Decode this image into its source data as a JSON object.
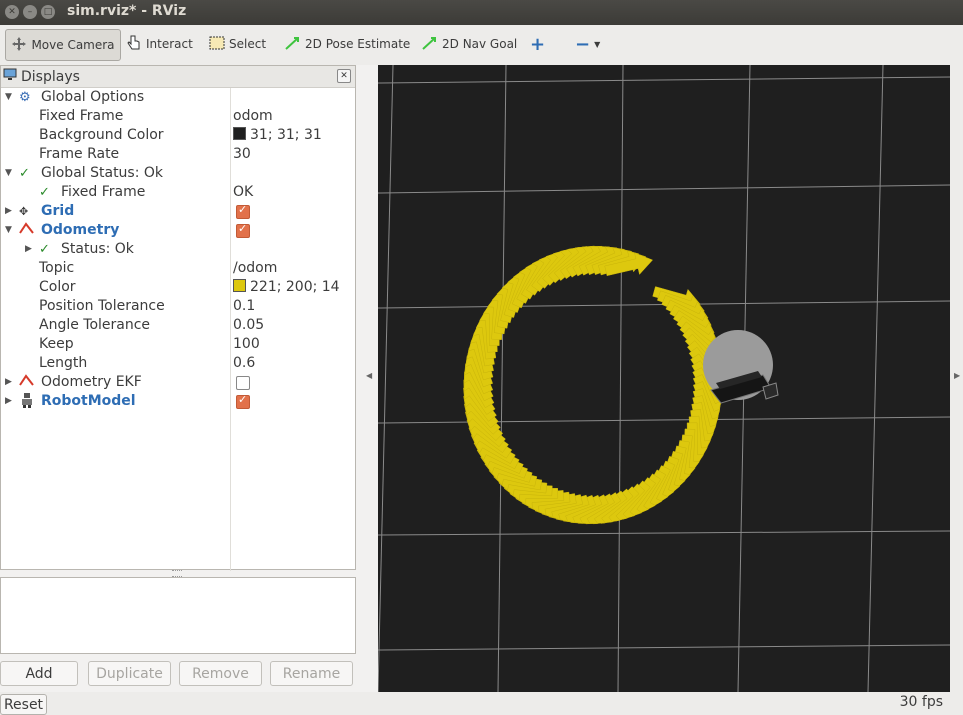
{
  "window": {
    "title": "sim.rviz* - RViz"
  },
  "toolbar": {
    "tools": [
      {
        "label": "Move Camera",
        "icon": "move-camera-icon"
      },
      {
        "label": "Interact",
        "icon": "hand-pointer-icon"
      },
      {
        "label": "Select",
        "icon": "select-box-icon"
      },
      {
        "label": "2D Pose Estimate",
        "icon": "green-arrow-icon"
      },
      {
        "label": "2D Nav Goal",
        "icon": "green-arrow-icon"
      }
    ],
    "add_icon": "plus-icon",
    "remove_icon": "minus-icon"
  },
  "displays": {
    "title": "Displays",
    "rows": [
      {
        "label": "Global Options",
        "value": ""
      },
      {
        "label": "Fixed Frame",
        "value": "odom"
      },
      {
        "label": "Background Color",
        "value": "31; 31; 31",
        "swatch": "#1f1f1f"
      },
      {
        "label": "Frame Rate",
        "value": "30"
      },
      {
        "label": "Global Status: Ok",
        "value": ""
      },
      {
        "label": "Fixed Frame",
        "value": "OK"
      },
      {
        "label": "Grid",
        "value": "",
        "checked": true
      },
      {
        "label": "Odometry",
        "value": "",
        "checked": true
      },
      {
        "label": "Status: Ok",
        "value": ""
      },
      {
        "label": "Topic",
        "value": "/odom"
      },
      {
        "label": "Color",
        "value": "221; 200; 14",
        "swatch": "#ddc80e"
      },
      {
        "label": "Position Tolerance",
        "value": "0.1"
      },
      {
        "label": "Angle Tolerance",
        "value": "0.05"
      },
      {
        "label": "Keep",
        "value": "100"
      },
      {
        "label": "Length",
        "value": "0.6"
      },
      {
        "label": "Odometry EKF",
        "value": "",
        "checked": false
      },
      {
        "label": "RobotModel",
        "value": "",
        "checked": true
      }
    ]
  },
  "buttons": {
    "add": "Add",
    "duplicate": "Duplicate",
    "remove": "Remove",
    "rename": "Rename"
  },
  "status": {
    "reset": "Reset",
    "fps": "30 fps"
  },
  "colors": {
    "background": "#1f1f1f",
    "odometry": "#ddc80e",
    "accent": "#e2714a",
    "link_blue": "#2e6db4"
  }
}
